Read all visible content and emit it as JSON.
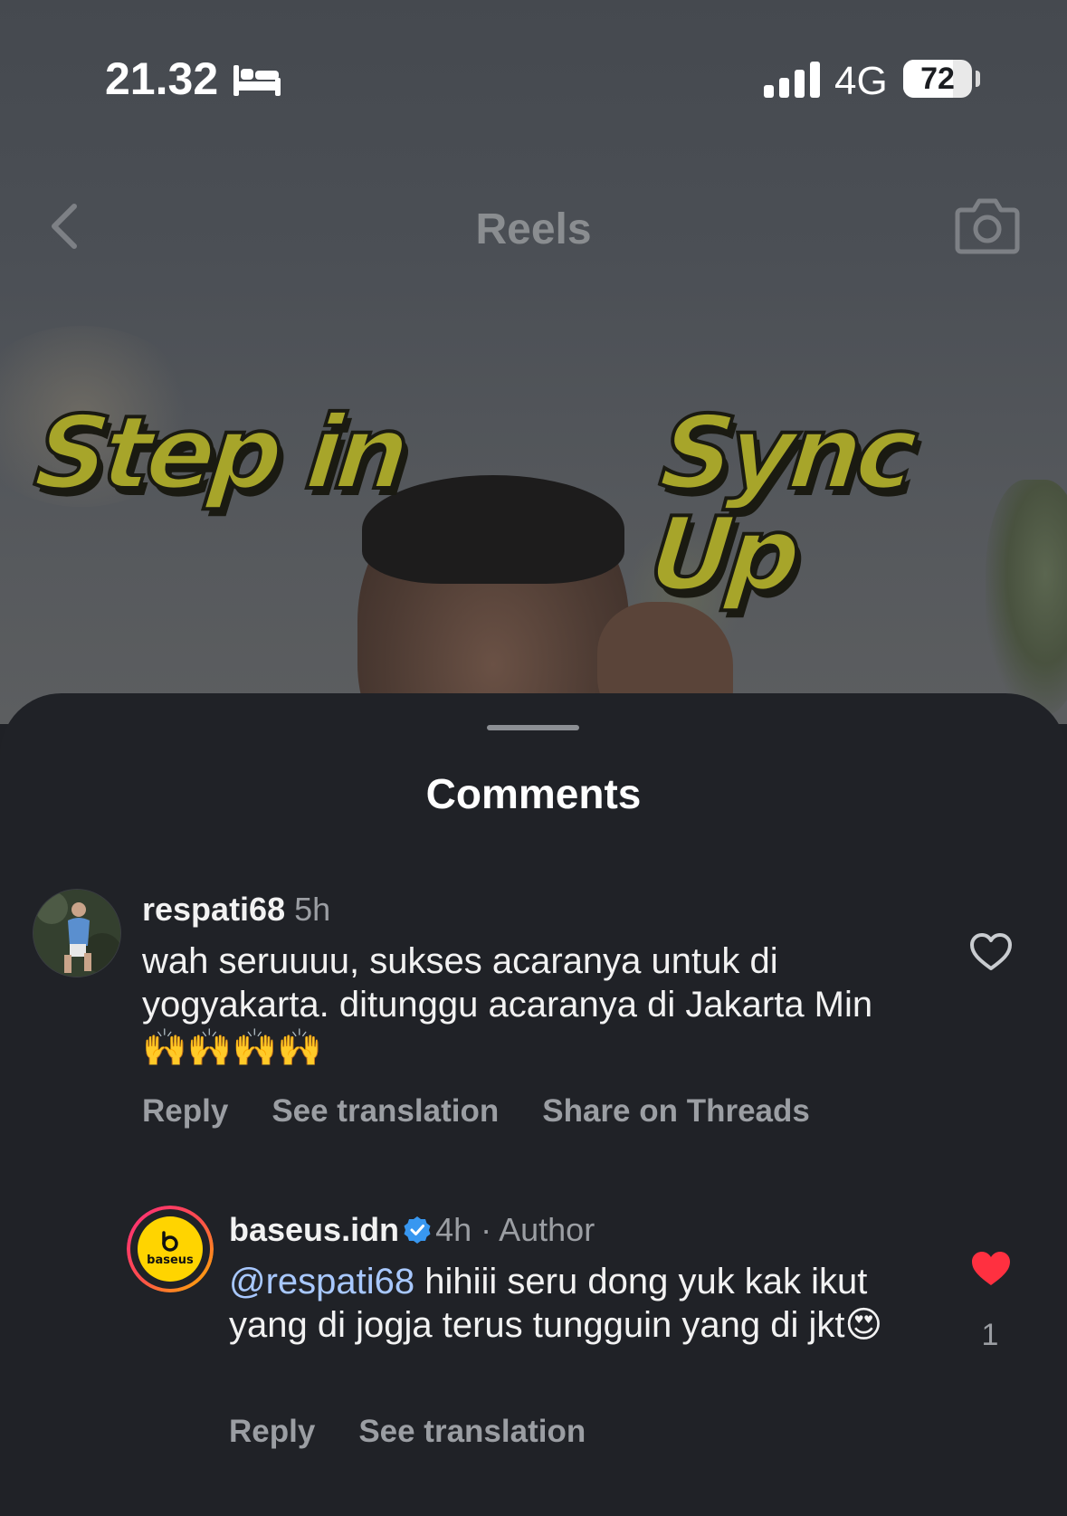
{
  "status_bar": {
    "time": "21.32",
    "network": "4G",
    "battery": "72",
    "battery_level": 0.72
  },
  "nav": {
    "title": "Reels"
  },
  "reel": {
    "overlay_left": "Step in",
    "overlay_right": "Sync Up"
  },
  "sheet": {
    "title": "Comments"
  },
  "comments": [
    {
      "username": "respati68",
      "time": "5h",
      "text": "wah seruuuu, sukses acaranya untuk di yogyakarta. ditunggu acaranya di Jakarta Min 🙌🙌🙌🙌",
      "actions": [
        "Reply",
        "See translation",
        "Share on Threads"
      ],
      "liked": false
    },
    {
      "username": "baseus.idn",
      "verified": true,
      "time": "4h",
      "role": "Author",
      "mention": "@respati68",
      "text": " hihiii seru dong yuk kak ikut yang di jogja terus tungguin yang di jkt😍",
      "actions": [
        "Reply",
        "See translation"
      ],
      "liked": true,
      "like_count": "1",
      "avatar_text": "baseus"
    }
  ],
  "colors": {
    "sheet_bg": "#202227",
    "heart_liked": "#ff3040",
    "mention": "#a8c8ff",
    "muted_text": "#9b9ea3",
    "brand_yellow": "#ffd400"
  },
  "icons": [
    "bed-icon",
    "signal-icon",
    "back-icon",
    "camera-icon",
    "heart-outline-icon",
    "heart-filled-icon",
    "verified-badge-icon"
  ]
}
